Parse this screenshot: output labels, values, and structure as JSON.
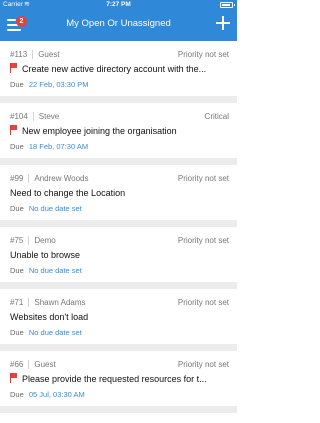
{
  "status_bar": {
    "carrier": "Carrier",
    "time": "7:27 PM"
  },
  "header": {
    "title": "My Open Or Unassigned",
    "badge_count": "2"
  },
  "tickets": [
    {
      "id": "#113",
      "requester": "Guest",
      "priority": "Priority not set",
      "subject": "Create new active directory account with the...",
      "flagged": true,
      "due_label": "Due",
      "due_value": "22 Feb, 03:30 PM"
    },
    {
      "id": "#104",
      "requester": "Steve",
      "priority": "Critical",
      "subject": "New employee joining the organisation",
      "flagged": true,
      "due_label": "Due",
      "due_value": "18 Feb, 07:30 AM"
    },
    {
      "id": "#99",
      "requester": "Andrew Woods",
      "priority": "Priority not set",
      "subject": "Need to change the Location",
      "flagged": false,
      "due_label": "Due",
      "due_value": "No due date set"
    },
    {
      "id": "#75",
      "requester": "Demo",
      "priority": "Priority not set",
      "subject": "Unable to browse",
      "flagged": false,
      "due_label": "Due",
      "due_value": "No due date set"
    },
    {
      "id": "#71",
      "requester": "Shawn Adams",
      "priority": "Priority not set",
      "subject": "Websites don't load",
      "flagged": false,
      "due_label": "Due",
      "due_value": "No due date set"
    },
    {
      "id": "#66",
      "requester": "Guest",
      "priority": "Priority not set",
      "subject": "Please provide the requested resources for t...",
      "flagged": true,
      "due_label": "Due",
      "due_value": "05 Jul, 03:30 AM"
    }
  ],
  "colors": {
    "header": "#2f89d8",
    "badge": "#e0433e",
    "flag": "#e2453f",
    "due_value": "#3a8ad6"
  },
  "icons": {
    "menu": "hamburger-menu-icon",
    "add": "plus-icon",
    "flag": "flag-icon"
  }
}
